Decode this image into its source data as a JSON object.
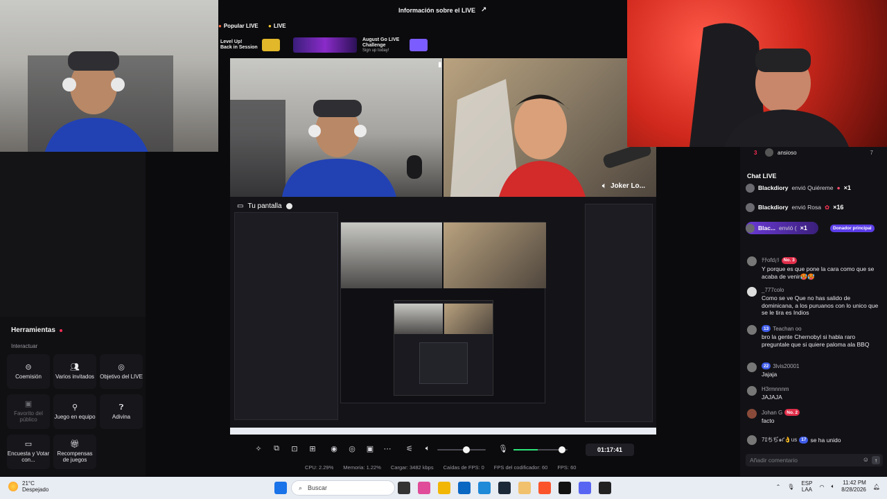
{
  "header": {
    "title": "Información sobre el LIVE",
    "pills": [
      "Popular LIVE",
      "LIVE"
    ],
    "banners": [
      {
        "title": "Level Up!",
        "subtitle": "Back in Session"
      },
      {
        "title": "",
        "subtitle": ""
      },
      {
        "title": "August Go LIVE Challenge",
        "subtitle": "Sign up today!"
      }
    ]
  },
  "stage": {
    "guest_name": "Joker Lo...",
    "screen_label": "Tu pantalla"
  },
  "tools": {
    "title": "Herramientas",
    "section": "Interactuar",
    "items": [
      {
        "label": "Coemisión",
        "icon": "co-host-icon"
      },
      {
        "label": "Varios invitados",
        "icon": "multi-guest-icon"
      },
      {
        "label": "Objetivo del LIVE",
        "icon": "target-icon"
      },
      {
        "label": "Favorito del público",
        "icon": "gift-icon"
      },
      {
        "label": "Juego en equipo",
        "icon": "team-game-icon"
      },
      {
        "label": "Adivina",
        "icon": "guess-icon"
      },
      {
        "label": "Encuesta y Votar con...",
        "icon": "poll-icon"
      },
      {
        "label": "Recompensas de juegos",
        "icon": "rewards-icon"
      }
    ]
  },
  "toolbar": {
    "timer": "01:17:41",
    "volume_level": 0.6,
    "mic_level": 0.45
  },
  "stats": {
    "cpu": "CPU: 2.29%",
    "memory": "Memoria: 1.22%",
    "upload": "Cargar: 3482 kbps",
    "fps_drops": "Caídas de FPS: 0",
    "encoder_fps": "FPS del codificador: 60",
    "fps": "FPS: 60"
  },
  "ranking": {
    "rank": "3",
    "name": "ansioso",
    "score": "7"
  },
  "chat": {
    "title": "Chat LIVE",
    "gifts": [
      {
        "name": "Blackdiory",
        "action": "envió Quiéreme",
        "count": "×1"
      },
      {
        "name": "Blackdiory",
        "action": "envió Rosa",
        "count": "×16"
      },
      {
        "name": "Blac...",
        "action": "envió (",
        "count": "×1",
        "tag": "Donador principal"
      }
    ],
    "messages": [
      {
        "user": "ﾁﾁofd¡ﾘ",
        "badge": "No. 3",
        "badge_color": "red",
        "text": "Y porque es que pone la cara como que se acaba de venir🥵🥵"
      },
      {
        "user": "_777colo",
        "badge": "",
        "badge_color": "",
        "text": "Como se ve Que no has salido de dominicana, a los puruanos con lo unico que se le tira es Indios"
      },
      {
        "user": "Teachan oo",
        "badge": "13",
        "badge_color": "blue",
        "text": "bro la gente Chernobyl si habla raro preguntale que si quiere paloma ala BBQ"
      },
      {
        "user": "3lvis20001",
        "badge": "22",
        "badge_color": "blue",
        "text": "Jajaja"
      },
      {
        "user": "H3rmnnnm",
        "badge": "",
        "badge_color": "",
        "text": "JAJAJA"
      },
      {
        "user": "Johan G",
        "badge": "No. 2",
        "badge_color": "red",
        "text": "facto"
      }
    ],
    "join": {
      "user": "7ﾛちぢ๑ґ👌us",
      "badge": "17",
      "text": "se ha unido"
    },
    "comment_placeholder": "Añadir comentario"
  },
  "taskbar": {
    "weather_temp": "21°C",
    "weather_desc": "Despejado",
    "search_label": "Buscar",
    "lang": "ESP",
    "lang_sub": "LAA",
    "time": "11:42 PM",
    "date": "8/28/2026"
  },
  "colors": {
    "accent": "#fe2c55",
    "chat_highlight": "#5b3ee8",
    "meter": "#2ee57a"
  }
}
